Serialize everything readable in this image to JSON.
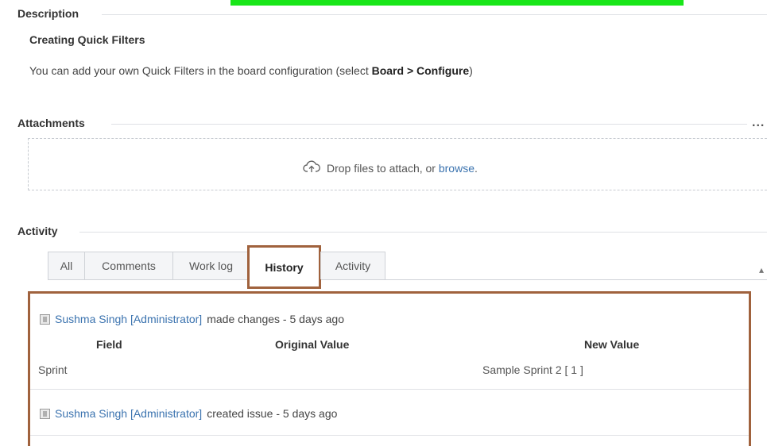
{
  "description": {
    "heading": "Description",
    "subheading": "Creating Quick Filters",
    "text_before": "You can add your own Quick Filters in the board configuration (select ",
    "text_bold": "Board > Configure",
    "text_after": ")"
  },
  "attachments": {
    "heading": "Attachments",
    "more_label": "...",
    "drop_text": "Drop files to attach, or ",
    "browse_label": "browse",
    "browse_suffix": "."
  },
  "activity": {
    "heading": "Activity",
    "tabs": [
      {
        "label": "All"
      },
      {
        "label": "Comments"
      },
      {
        "label": "Work log"
      },
      {
        "label": "History",
        "active": true
      },
      {
        "label": "Activity"
      }
    ],
    "history": {
      "entries": [
        {
          "user": "Sushma Singh [Administrator]",
          "action": "made changes - 5 days ago",
          "columns": [
            "Field",
            "Original Value",
            "New Value"
          ],
          "row": {
            "field": "Sprint",
            "original": "",
            "new": "Sample Sprint 2 [ 1 ]"
          }
        },
        {
          "user": "Sushma Singh [Administrator]",
          "action": "created issue - 5 days ago"
        }
      ]
    }
  },
  "colors": {
    "highlight_border": "#a0623d",
    "link": "#3b73af",
    "top_bar": "#19e619"
  }
}
